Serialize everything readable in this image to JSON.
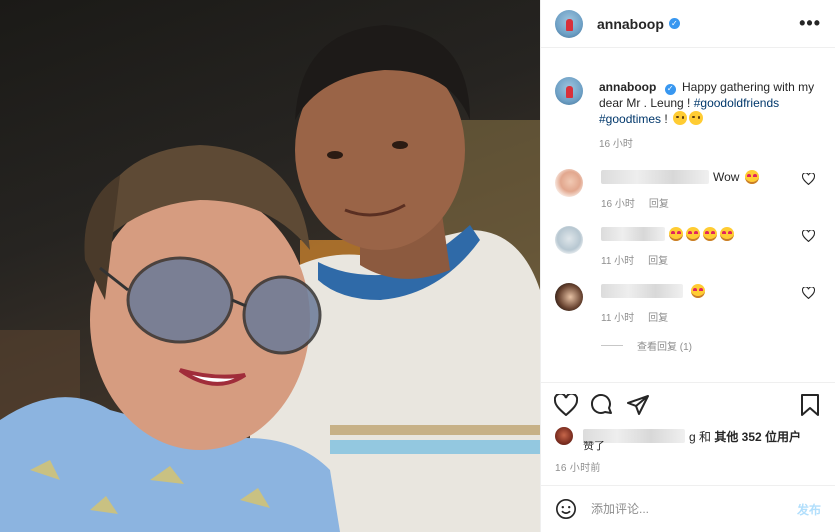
{
  "post": {
    "username": "annaboop",
    "verified_mark": "✓",
    "more_label": "•••"
  },
  "caption": {
    "username": "annaboop",
    "text": "Happy gathering with my dear Mr . Leung ! ",
    "tag1": "#goodoldfriends",
    "tag2": "#goodtimes",
    "tail": " ! ",
    "time": "16 小时"
  },
  "comments": [
    {
      "text": "Wow",
      "time": "16 小时",
      "reply": "回复",
      "emoji": [
        "heart-eyes"
      ]
    },
    {
      "text": "",
      "time": "11 小时",
      "reply": "回复",
      "emoji": [
        "heart-eyes",
        "heart-eyes",
        "heart-eyes",
        "heart-eyes"
      ]
    },
    {
      "text": "",
      "time": "11 小时",
      "reply": "回复",
      "emoji": [
        "heart-eyes"
      ]
    }
  ],
  "view_replies": "查看回复 (1)",
  "likes": {
    "suffix": "g 和 ",
    "others": "其他 352 位用户",
    "zan": "赞了"
  },
  "post_time": "16 小时前",
  "compose": {
    "placeholder": "添加评论...",
    "post_label": "发布"
  },
  "icons": {
    "verified": "verified-badge-icon",
    "more": "more-options-icon",
    "like": "heart-icon",
    "comment": "comment-bubble-icon",
    "share": "paper-plane-icon",
    "save": "bookmark-icon",
    "emoji": "smiley-icon"
  },
  "colors": {
    "verified": "#3897f0",
    "hashtag": "#00376b",
    "muted": "#8e8e8e",
    "post_disabled": "#b2dffc"
  }
}
